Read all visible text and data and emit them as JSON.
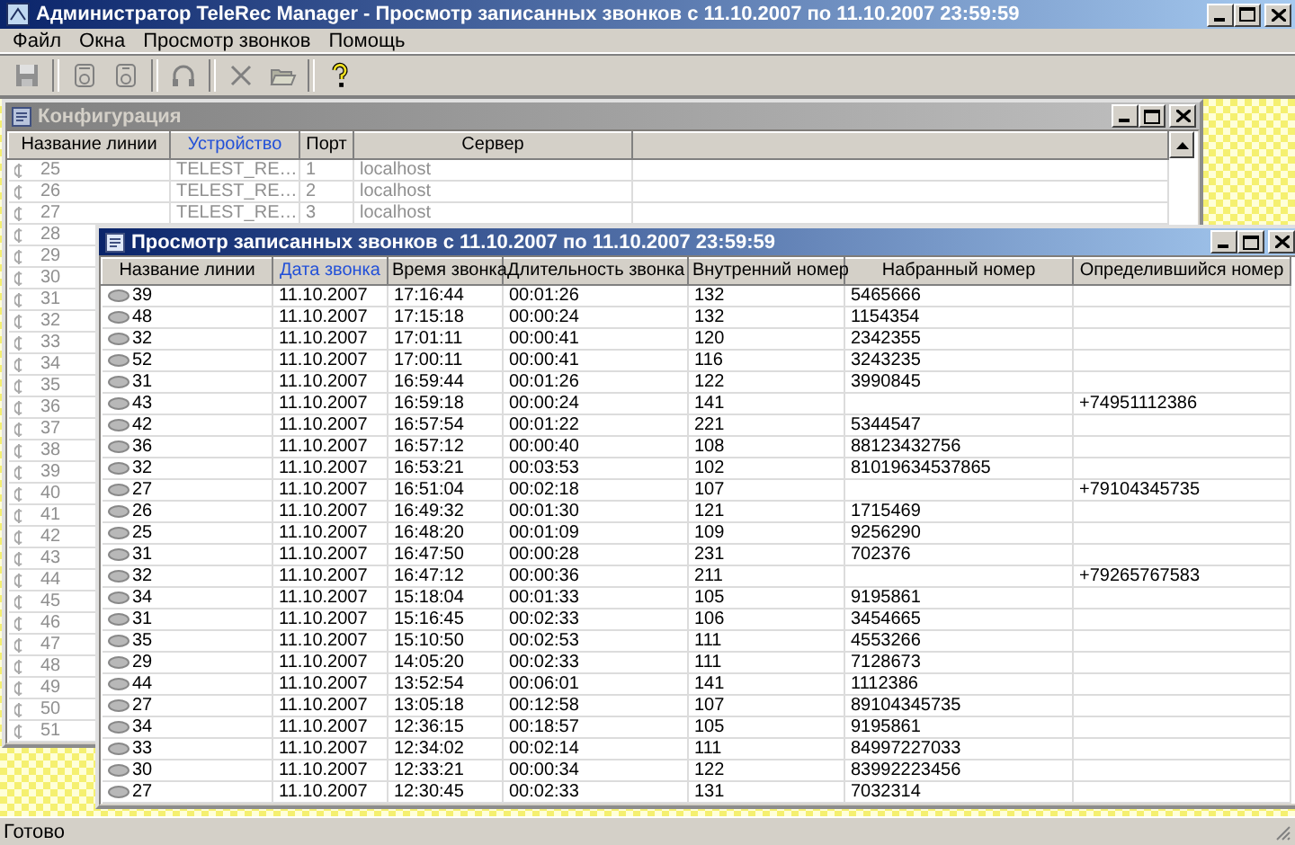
{
  "window": {
    "title": "Администратор TeleRec Manager - Просмотр записанных звонков с 11.10.2007 по 11.10.2007 23:59:59"
  },
  "menu": [
    "Файл",
    "Окна",
    "Просмотр звонков",
    "Помощь"
  ],
  "config_window": {
    "title": "Конфигурация",
    "active": false,
    "columns": [
      {
        "label": "Название линии",
        "sorted": false
      },
      {
        "label": "Устройство",
        "sorted": true
      },
      {
        "label": "Порт",
        "sorted": false
      },
      {
        "label": "Сервер",
        "sorted": false
      }
    ],
    "rows": [
      {
        "line": "25",
        "device": "TELEST_RE…",
        "port": "1",
        "server": "localhost"
      },
      {
        "line": "26",
        "device": "TELEST_RE…",
        "port": "2",
        "server": "localhost"
      },
      {
        "line": "27",
        "device": "TELEST_RE…",
        "port": "3",
        "server": "localhost"
      },
      {
        "line": "28"
      },
      {
        "line": "29"
      },
      {
        "line": "30"
      },
      {
        "line": "31"
      },
      {
        "line": "32"
      },
      {
        "line": "33"
      },
      {
        "line": "34"
      },
      {
        "line": "35"
      },
      {
        "line": "36"
      },
      {
        "line": "37"
      },
      {
        "line": "38"
      },
      {
        "line": "39"
      },
      {
        "line": "40"
      },
      {
        "line": "41"
      },
      {
        "line": "42"
      },
      {
        "line": "43"
      },
      {
        "line": "44"
      },
      {
        "line": "45"
      },
      {
        "line": "46"
      },
      {
        "line": "47"
      },
      {
        "line": "48"
      },
      {
        "line": "49"
      },
      {
        "line": "50"
      },
      {
        "line": "51"
      }
    ]
  },
  "calls_window": {
    "title": "Просмотр записанных звонков с 11.10.2007 по 11.10.2007 23:59:59",
    "active": true,
    "columns": [
      {
        "label": "Название линии",
        "sorted": false
      },
      {
        "label": "Дата звонка",
        "sorted": true
      },
      {
        "label": "Время звонка",
        "sorted": false
      },
      {
        "label": "Длительность звонка",
        "sorted": false
      },
      {
        "label": "Внутренний номер",
        "sorted": false
      },
      {
        "label": "Набранный номер",
        "sorted": false
      },
      {
        "label": "Определившийся номер",
        "sorted": false
      }
    ],
    "rows": [
      {
        "line": "39",
        "date": "11.10.2007",
        "time": "17:16:44",
        "duration": "00:01:26",
        "extension": "132",
        "dialed": "5465666"
      },
      {
        "line": "48",
        "date": "11.10.2007",
        "time": "17:15:18",
        "duration": "00:00:24",
        "extension": "132",
        "dialed": "1154354"
      },
      {
        "line": "32",
        "date": "11.10.2007",
        "time": "17:01:11",
        "duration": "00:00:41",
        "extension": "120",
        "dialed": "2342355"
      },
      {
        "line": "52",
        "date": "11.10.2007",
        "time": "17:00:11",
        "duration": "00:00:41",
        "extension": "116",
        "dialed": "3243235"
      },
      {
        "line": "31",
        "date": "11.10.2007",
        "time": "16:59:44",
        "duration": "00:01:26",
        "extension": "122",
        "dialed": "3990845"
      },
      {
        "line": "43",
        "date": "11.10.2007",
        "time": "16:59:18",
        "duration": "00:00:24",
        "extension": "141",
        "caller_id": "+74951112386"
      },
      {
        "line": "42",
        "date": "11.10.2007",
        "time": "16:57:54",
        "duration": "00:01:22",
        "extension": "221",
        "dialed": "5344547"
      },
      {
        "line": "36",
        "date": "11.10.2007",
        "time": "16:57:12",
        "duration": "00:00:40",
        "extension": "108",
        "dialed": "88123432756"
      },
      {
        "line": "32",
        "date": "11.10.2007",
        "time": "16:53:21",
        "duration": "00:03:53",
        "extension": "102",
        "dialed": "81019634537865"
      },
      {
        "line": "27",
        "date": "11.10.2007",
        "time": "16:51:04",
        "duration": "00:02:18",
        "extension": "107",
        "caller_id": "+79104345735"
      },
      {
        "line": "26",
        "date": "11.10.2007",
        "time": "16:49:32",
        "duration": "00:01:30",
        "extension": "121",
        "dialed": "1715469"
      },
      {
        "line": "25",
        "date": "11.10.2007",
        "time": "16:48:20",
        "duration": "00:01:09",
        "extension": "109",
        "dialed": "9256290"
      },
      {
        "line": "31",
        "date": "11.10.2007",
        "time": "16:47:50",
        "duration": "00:00:28",
        "extension": "231",
        "dialed": "702376"
      },
      {
        "line": "32",
        "date": "11.10.2007",
        "time": "16:47:12",
        "duration": "00:00:36",
        "extension": "211",
        "caller_id": "+79265767583"
      },
      {
        "line": "34",
        "date": "11.10.2007",
        "time": "15:18:04",
        "duration": "00:01:33",
        "extension": "105",
        "dialed": "9195861"
      },
      {
        "line": "31",
        "date": "11.10.2007",
        "time": "15:16:45",
        "duration": "00:02:33",
        "extension": "106",
        "dialed": "3454665"
      },
      {
        "line": "35",
        "date": "11.10.2007",
        "time": "15:10:50",
        "duration": "00:02:53",
        "extension": "111",
        "dialed": "4553266"
      },
      {
        "line": "29",
        "date": "11.10.2007",
        "time": "14:05:20",
        "duration": "00:02:33",
        "extension": "111",
        "dialed": "7128673"
      },
      {
        "line": "44",
        "date": "11.10.2007",
        "time": "13:52:54",
        "duration": "00:06:01",
        "extension": "141",
        "dialed": "1112386"
      },
      {
        "line": "27",
        "date": "11.10.2007",
        "time": "13:05:18",
        "duration": "00:12:58",
        "extension": "107",
        "dialed": "89104345735"
      },
      {
        "line": "34",
        "date": "11.10.2007",
        "time": "12:36:15",
        "duration": "00:18:57",
        "extension": "105",
        "dialed": "9195861"
      },
      {
        "line": "33",
        "date": "11.10.2007",
        "time": "12:34:02",
        "duration": "00:02:14",
        "extension": "111",
        "dialed": "84997227033"
      },
      {
        "line": "30",
        "date": "11.10.2007",
        "time": "12:33:21",
        "duration": "00:00:34",
        "extension": "122",
        "dialed": "83992223456"
      },
      {
        "line": "27",
        "date": "11.10.2007",
        "time": "12:30:45",
        "duration": "00:02:33",
        "extension": "131",
        "dialed": "7032314"
      }
    ]
  },
  "status_bar": {
    "text": "Готово"
  }
}
